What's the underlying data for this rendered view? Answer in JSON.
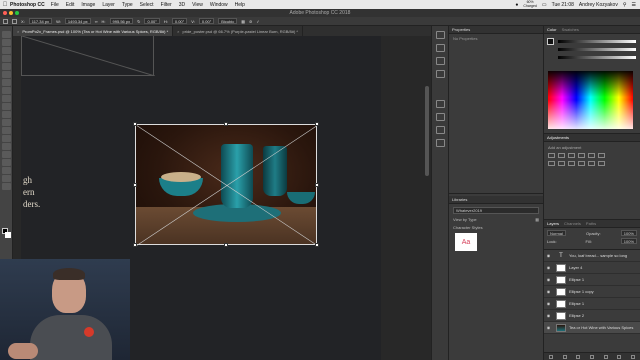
{
  "menubar": {
    "apple_icon": "",
    "app_name": "Photoshop CC",
    "items": [
      "File",
      "Edit",
      "Image",
      "Layer",
      "Type",
      "Select",
      "Filter",
      "3D",
      "View",
      "Window",
      "Help"
    ],
    "battery_top": "60%",
    "battery_bottom": "Charged",
    "clock": "Tue 21:08",
    "user": "Andrey Kozyakov"
  },
  "titlebar": {
    "title": "Adobe Photoshop CC 2018"
  },
  "optbar": {
    "x": "117.34 px",
    "w": "1493.34 px",
    "h": "995.56 px",
    "angle": "0.00°",
    "h_skew": "0.00°",
    "v_skew": "0.00°",
    "interp": "Bicubic"
  },
  "doctabs": [
    {
      "label": "PromPo2x_Frames.psd @ 100% (Tea or Hot Wine with Various Spices, RGB/8#) *",
      "active": true
    },
    {
      "label": "pride_poster.psd @ 66.7% (Purple-pastel Linear Burn, RGB/8#) *",
      "active": false
    }
  ],
  "canvas": {
    "art_text": [
      "gh",
      "ern",
      "ders."
    ]
  },
  "properties": {
    "title": "Properties",
    "empty_text": "No Properties"
  },
  "libraries": {
    "title": "Libraries",
    "selected_library": "Whatever2019",
    "view_label": "View by Type",
    "section": "Character Styles",
    "thumb_text": "Aa"
  },
  "color_panel": {
    "tabs": [
      "Color",
      "Swatches"
    ]
  },
  "adjustments": {
    "title": "Adjustments",
    "label": "Add an adjustment"
  },
  "layers": {
    "tabs": [
      "Layers",
      "Channels",
      "Paths"
    ],
    "blend_mode": "Normal",
    "opacity_label": "Opacity:",
    "opacity_value": "100%",
    "lock_label": "Lock:",
    "fill_label": "Fill:",
    "fill_value": "100%",
    "items": [
      {
        "name": "You, loaf bread... sample so long",
        "kind": "text"
      },
      {
        "name": "Layer 4",
        "kind": "shape"
      },
      {
        "name": "Ellipse 1",
        "kind": "shape"
      },
      {
        "name": "Ellipse 1 copy",
        "kind": "shape"
      },
      {
        "name": "Ellipse 1",
        "kind": "shape"
      },
      {
        "name": "Ellipse 2",
        "kind": "shape"
      },
      {
        "name": "Tea or Hot Wine with Various Spices",
        "kind": "image"
      }
    ]
  }
}
